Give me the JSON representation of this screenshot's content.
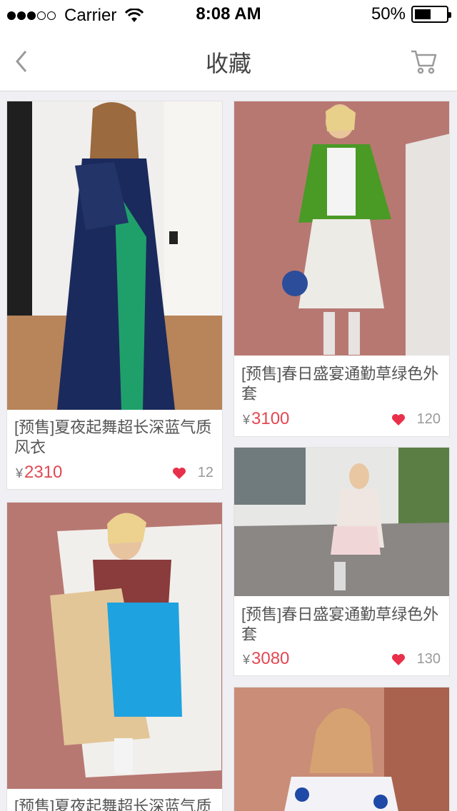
{
  "status_bar": {
    "carrier": "Carrier",
    "time": "8:08 AM",
    "battery": "50%",
    "signal_filled": 3,
    "signal_total": 5,
    "battery_level": 0.5
  },
  "nav": {
    "title": "收藏",
    "back_icon": "chevron-left-icon",
    "cart_icon": "cart-icon"
  },
  "colors": {
    "price": "#e24852",
    "heart": "#e8304a",
    "background": "#efeff4"
  },
  "currency_symbol": "¥",
  "products": [
    {
      "name": "[预售]夏夜起舞超长深蓝气质风衣",
      "price": "2310",
      "likes": "12"
    },
    {
      "name": "[预售]春日盛宴通勤草绿色外套",
      "price": "3100",
      "likes": "120"
    },
    {
      "name": "[预售]春日盛宴通勤草绿色外套",
      "price": "3080",
      "likes": "130"
    },
    {
      "name": "[预售]夏夜起舞超长深蓝气质风衣",
      "price": "",
      "likes": ""
    },
    {
      "name": "",
      "price": "",
      "likes": ""
    }
  ]
}
